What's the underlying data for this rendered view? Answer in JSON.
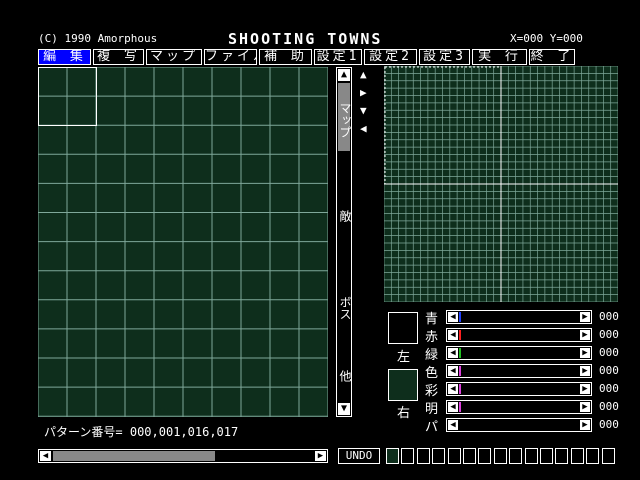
{
  "header": {
    "copyright": "(C) 1990 Amorphous",
    "title": "SHOOTING  TOWNS",
    "coords": "X=000  Y=000"
  },
  "menu": [
    {
      "label": "編 集",
      "active": true,
      "w": 55
    },
    {
      "label": "複 写",
      "active": false,
      "w": 53
    },
    {
      "label": "マップ",
      "active": false,
      "w": 58
    },
    {
      "label": "ファイル",
      "active": false,
      "w": 55
    },
    {
      "label": "補 助",
      "active": false,
      "w": 55
    },
    {
      "label": "設定1",
      "active": false,
      "w": 50
    },
    {
      "label": "設定2",
      "active": false,
      "w": 55
    },
    {
      "label": "設定3",
      "active": false,
      "w": 53
    },
    {
      "label": "実 行",
      "active": false,
      "w": 57
    },
    {
      "label": "終 了",
      "active": false,
      "w": 48
    }
  ],
  "vscroll": {
    "labels": [
      "マップ",
      "敵",
      "ボス",
      "他"
    ]
  },
  "colors": {
    "grid_bg": "#0e2e1c",
    "grid_line": "#7fa89a",
    "left_color": "#000000",
    "right_color": "#0e2e1c"
  },
  "color_panel": {
    "left_label": "左",
    "right_label": "右",
    "sliders": [
      {
        "label": "青",
        "value": "000",
        "fill": "#2040ff"
      },
      {
        "label": "赤",
        "value": "000",
        "fill": "#ff2020"
      },
      {
        "label": "緑",
        "value": "000",
        "fill": "#20c020"
      },
      {
        "label": "色",
        "value": "000",
        "fill": "#e040e0"
      },
      {
        "label": "彩",
        "value": "000",
        "fill": "#e040e0"
      },
      {
        "label": "明",
        "value": "000",
        "fill": "#e040e0"
      },
      {
        "label": "パ",
        "value": "000",
        "fill": "#000000"
      }
    ]
  },
  "footer": {
    "pattern_number": "パターン番号= 000,001,016,017",
    "undo": "UNDO"
  }
}
